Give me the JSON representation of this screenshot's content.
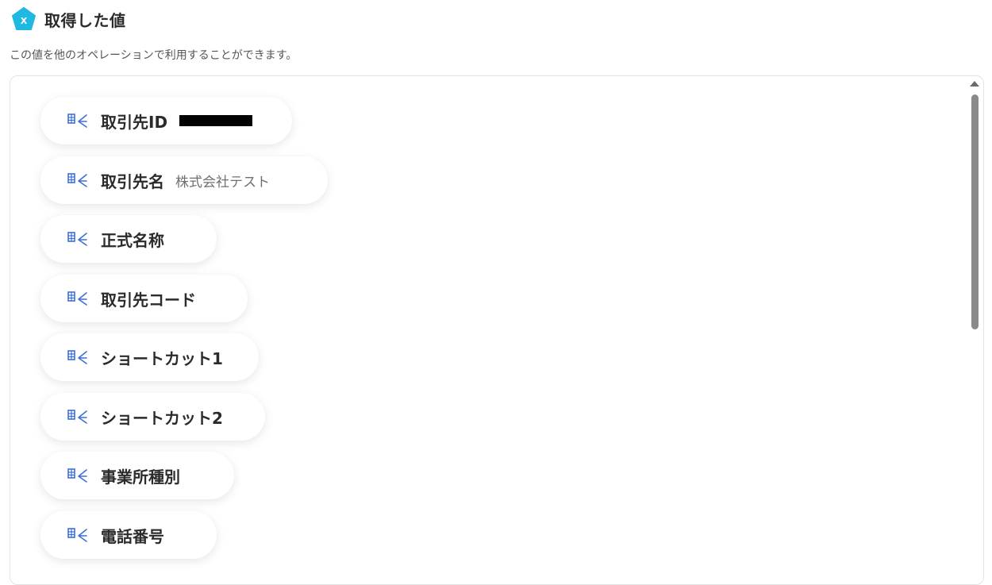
{
  "header": {
    "icon": "x-pentagon-icon",
    "icon_letter": "x",
    "title": "取得した値"
  },
  "subtitle": "この値を他のオペレーションで利用することができます。",
  "colors": {
    "accent": "#1fb8e0",
    "icon_blue": "#3f6fd6",
    "text": "#2b2b2b",
    "muted": "#6f6f6f"
  },
  "items": [
    {
      "label": "取引先ID",
      "value": "",
      "redacted": true
    },
    {
      "label": "取引先名",
      "value": "株式会社テスト"
    },
    {
      "label": "正式名称",
      "value": ""
    },
    {
      "label": "取引先コード",
      "value": ""
    },
    {
      "label": "ショートカット1",
      "value": ""
    },
    {
      "label": "ショートカット2",
      "value": ""
    },
    {
      "label": "事業所種別",
      "value": ""
    },
    {
      "label": "電話番号",
      "value": ""
    }
  ]
}
